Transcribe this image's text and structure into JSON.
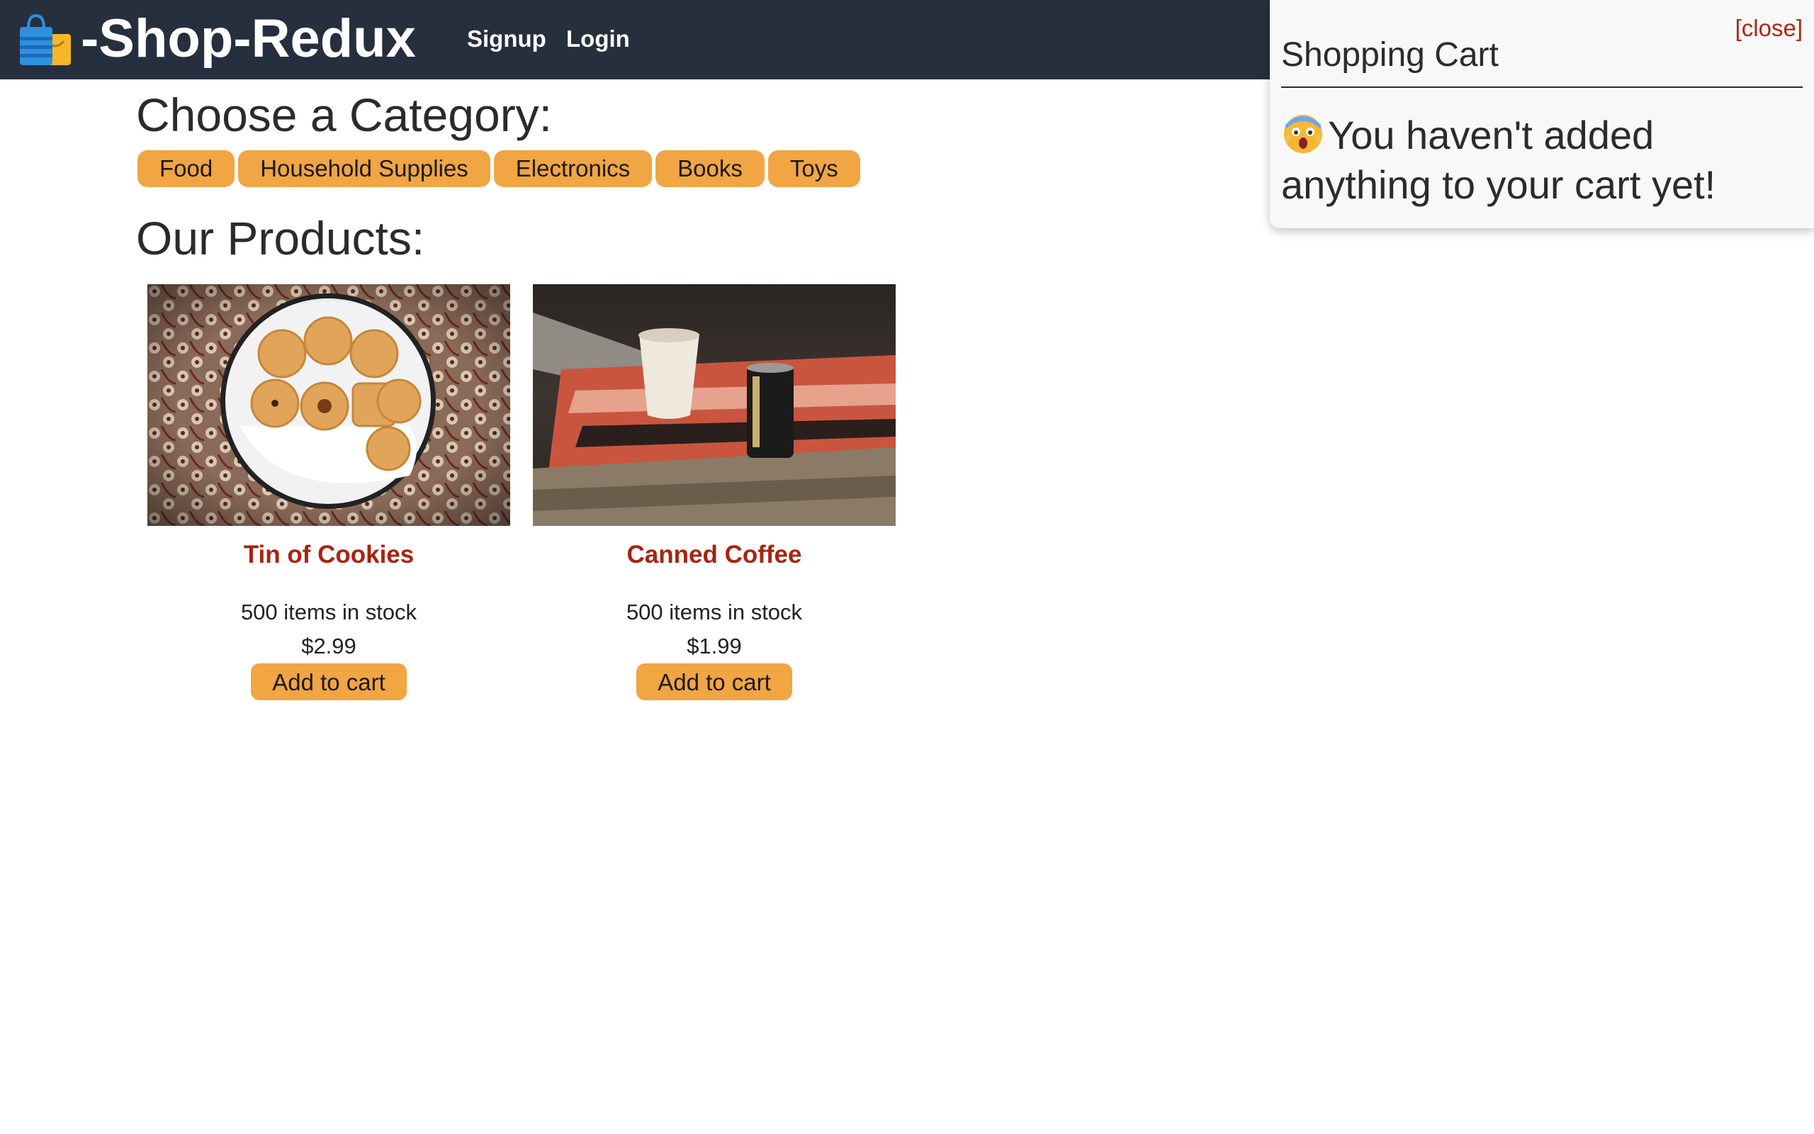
{
  "header": {
    "brand": "-Shop-Redux",
    "nav": {
      "signup": "Signup",
      "login": "Login"
    },
    "logo_icon": "shopping-bags-icon"
  },
  "main": {
    "category_heading": "Choose a Category:",
    "categories": [
      "Food",
      "Household Supplies",
      "Electronics",
      "Books",
      "Toys"
    ],
    "products_heading": "Our Products:",
    "products": [
      {
        "name": "Tin of Cookies",
        "stock": "500 items in stock",
        "price": "$2.99",
        "button": "Add to cart"
      },
      {
        "name": "Canned Coffee",
        "stock": "500 items in stock",
        "price": "$1.99",
        "button": "Add to cart"
      }
    ]
  },
  "cart": {
    "close": "[close]",
    "title": "Shopping Cart",
    "empty_message": "You haven't added anything to your cart yet!",
    "emoji_icon": "screaming-face-icon"
  },
  "colors": {
    "header_bg": "#252f3e",
    "button_bg": "#f1a543",
    "product_name": "#a8230f",
    "close_link": "#b0260f"
  }
}
